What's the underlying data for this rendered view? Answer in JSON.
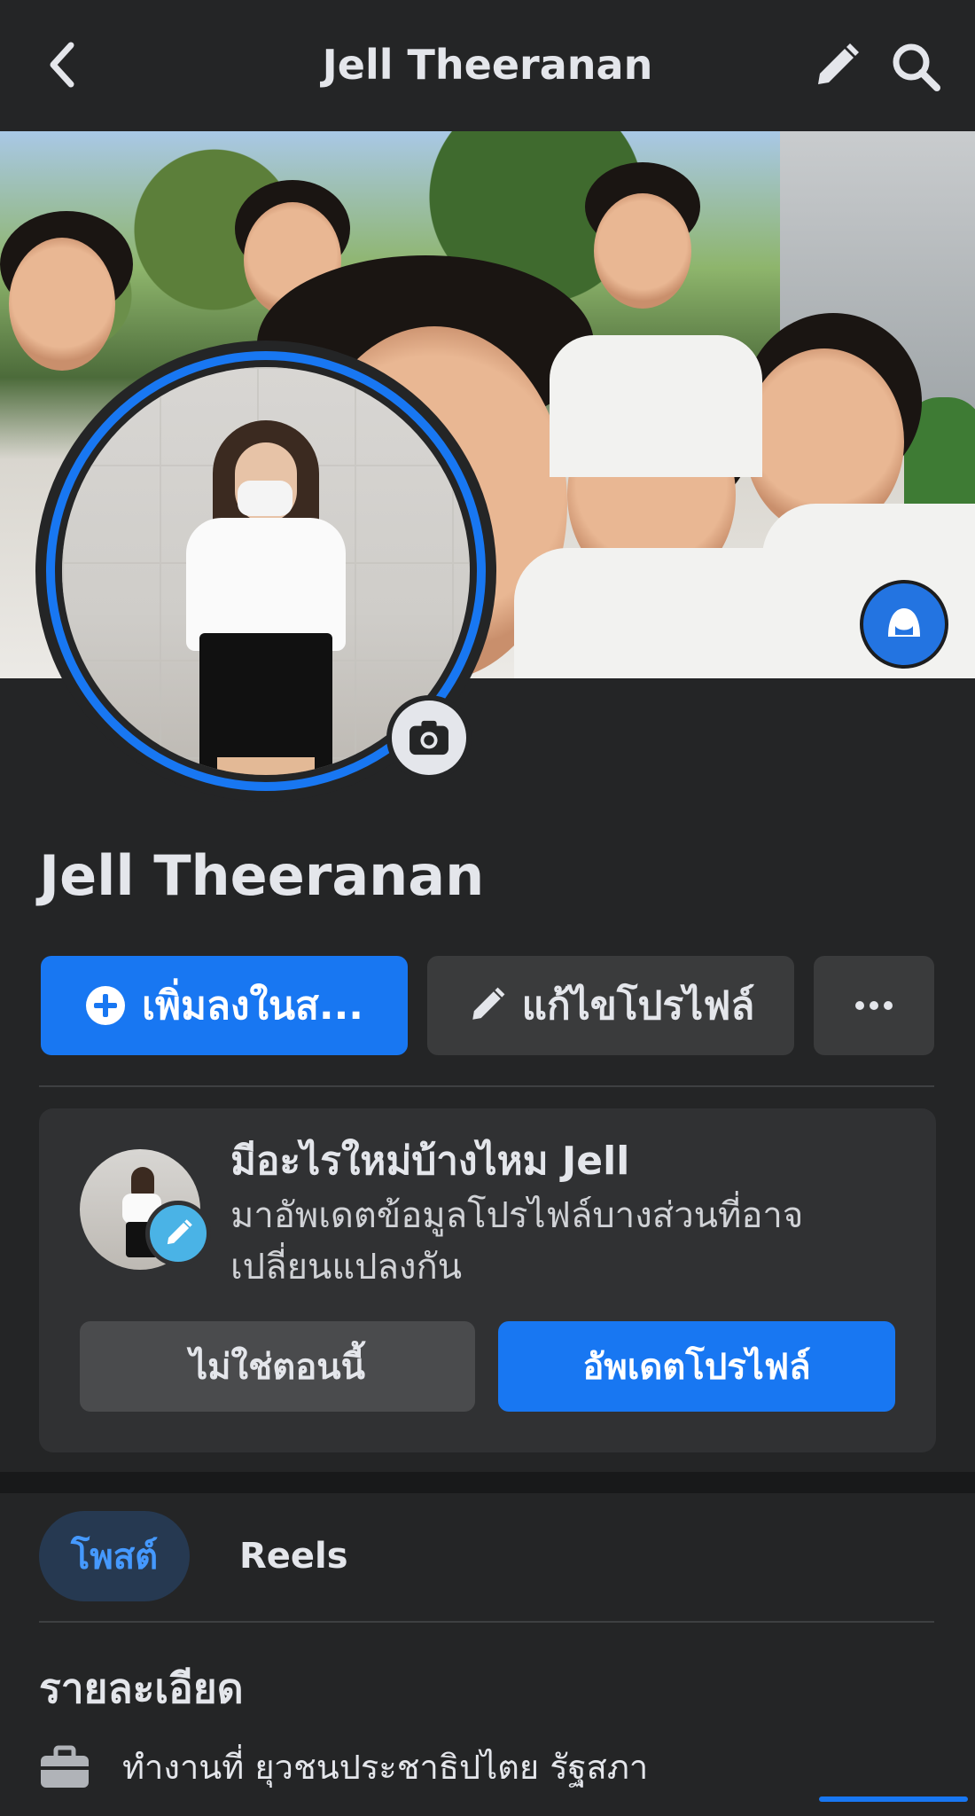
{
  "header": {
    "title": "Jell Theeranan",
    "back_icon": "chevron-left-icon",
    "edit_icon": "pencil-icon",
    "search_icon": "search-icon"
  },
  "profile": {
    "name": "Jell Theeranan"
  },
  "actions": {
    "add_story_label": "เพิ่มลงในส...",
    "edit_profile_label": "แก้ไขโปรไฟล์",
    "more_label": "···"
  },
  "update_card": {
    "headline": "มีอะไรใหม่บ้างไหม Jell",
    "description": "มาอัพเดตข้อมูลโปรไฟล์บางส่วนที่อาจเปลี่ยนแปลงกัน",
    "not_now_label": "ไม่ใช่ตอนนี้",
    "update_label": "อัพเดตโปรไฟล์"
  },
  "tabs": [
    {
      "label": "โพสต์",
      "active": true
    },
    {
      "label": "Reels",
      "active": false
    }
  ],
  "details": {
    "title": "รายละเอียด",
    "work": "ทำงานที่ ยุวชนประชาธิปไตย รัฐสภา"
  },
  "colors": {
    "accent": "#1877f2",
    "background": "#242526",
    "button_secondary": "#3a3b3c"
  }
}
